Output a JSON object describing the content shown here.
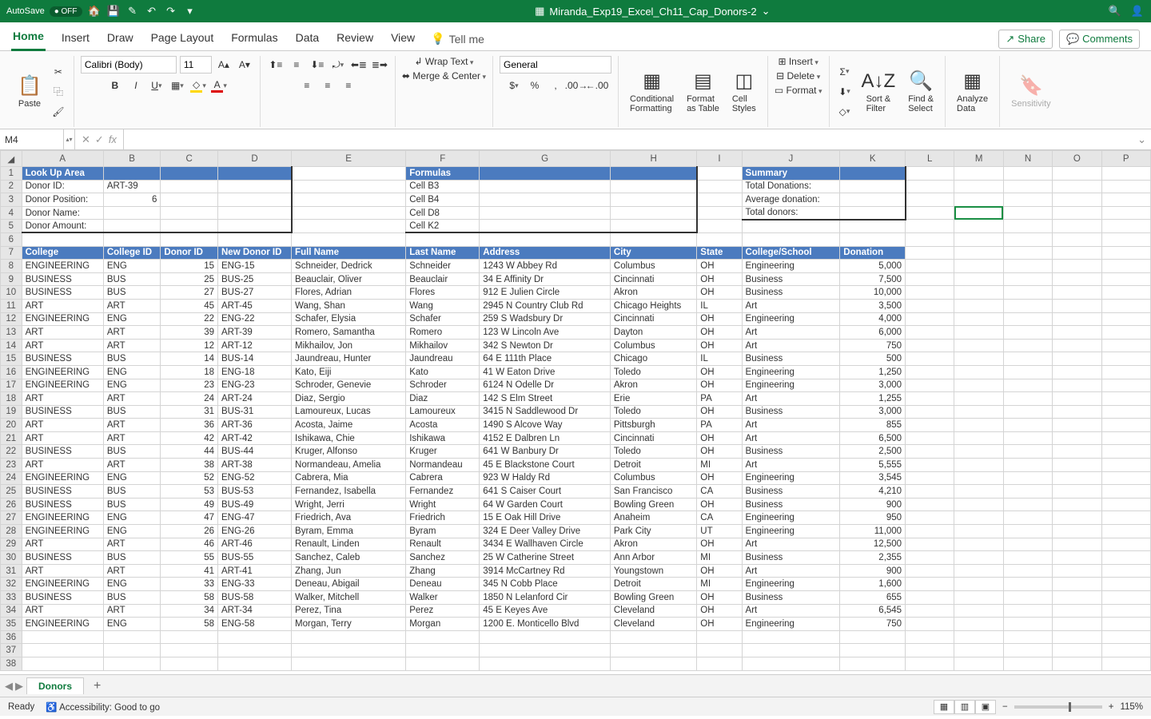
{
  "titlebar": {
    "autosave_label": "AutoSave",
    "autosave_state": "OFF",
    "filename": "Miranda_Exp19_Excel_Ch11_Cap_Donors-2",
    "icons": {
      "home": "🏠",
      "save": "💾",
      "share": "✎",
      "undo": "↶",
      "redo": "↷",
      "more": "⋯",
      "search": "🔍",
      "user": "👤"
    }
  },
  "ribbon_tabs": [
    "Home",
    "Insert",
    "Draw",
    "Page Layout",
    "Formulas",
    "Data",
    "Review",
    "View"
  ],
  "tellme_label": "Tell me",
  "share_label": "Share",
  "comments_label": "Comments",
  "ribbon": {
    "paste_label": "Paste",
    "font_name": "Calibri (Body)",
    "font_size": "11",
    "wrap_label": "Wrap Text",
    "merge_label": "Merge & Center",
    "number_format": "General",
    "cond_fmt_label": "Conditional\nFormatting",
    "fmt_table_label": "Format\nas Table",
    "cell_styles_label": "Cell\nStyles",
    "insert_label": "Insert",
    "delete_label": "Delete",
    "format_label": "Format",
    "sort_label": "Sort &\nFilter",
    "find_label": "Find &\nSelect",
    "analyze_label": "Analyze\nData",
    "sensitivity_label": "Sensitivity"
  },
  "namebox": "M4",
  "columns": [
    "A",
    "B",
    "C",
    "D",
    "E",
    "F",
    "G",
    "H",
    "I",
    "J",
    "K",
    "L",
    "M",
    "N",
    "O",
    "P"
  ],
  "active_col": "M",
  "sel_cell": "M4",
  "lookup_area_hdr": "Look Up Area",
  "formulas_hdr": "Formulas",
  "summary_hdr": "Summary",
  "lookup": {
    "donor_id_lbl": "Donor ID:",
    "donor_id_val": "ART-39",
    "donor_pos_lbl": "Donor Position:",
    "donor_pos_val": "6",
    "donor_name_lbl": "Donor Name:",
    "donor_amt_lbl": "Donor Amount:"
  },
  "formulas_cells": [
    "Cell B3",
    "Cell B4",
    "Cell D8",
    "Cell K2"
  ],
  "summary": {
    "total_don_lbl": "Total Donations:",
    "avg_don_lbl": "Average donation:",
    "total_donors_lbl": "Total donors:"
  },
  "headers": [
    "College",
    "College ID",
    "Donor ID",
    "New Donor ID",
    "Full Name",
    "Last Name",
    "Address",
    "City",
    "State",
    "College/School",
    "Donation"
  ],
  "rows": [
    [
      "ENGINEERING",
      "ENG",
      "15",
      "ENG-15",
      "Schneider, Dedrick",
      "Schneider",
      "1243 W Abbey Rd",
      "Columbus",
      "OH",
      "Engineering",
      "5,000"
    ],
    [
      "BUSINESS",
      "BUS",
      "25",
      "BUS-25",
      "Beauclair, Oliver",
      "Beauclair",
      "34 E Affinity Dr",
      "Cincinnati",
      "OH",
      "Business",
      "7,500"
    ],
    [
      "BUSINESS",
      "BUS",
      "27",
      "BUS-27",
      "Flores, Adrian",
      "Flores",
      "912 E Julien Circle",
      "Akron",
      "OH",
      "Business",
      "10,000"
    ],
    [
      "ART",
      "ART",
      "45",
      "ART-45",
      "Wang, Shan",
      "Wang",
      "2945 N Country Club Rd",
      "Chicago Heights",
      "IL",
      "Art",
      "3,500"
    ],
    [
      "ENGINEERING",
      "ENG",
      "22",
      "ENG-22",
      "Schafer, Elysia",
      "Schafer",
      "259 S Wadsbury Dr",
      "Cincinnati",
      "OH",
      "Engineering",
      "4,000"
    ],
    [
      "ART",
      "ART",
      "39",
      "ART-39",
      "Romero, Samantha",
      "Romero",
      "123 W Lincoln Ave",
      "Dayton",
      "OH",
      "Art",
      "6,000"
    ],
    [
      "ART",
      "ART",
      "12",
      "ART-12",
      "Mikhailov, Jon",
      "Mikhailov",
      "342 S Newton Dr",
      "Columbus",
      "OH",
      "Art",
      "750"
    ],
    [
      "BUSINESS",
      "BUS",
      "14",
      "BUS-14",
      "Jaundreau, Hunter",
      "Jaundreau",
      "64 E 111th Place",
      "Chicago",
      "IL",
      "Business",
      "500"
    ],
    [
      "ENGINEERING",
      "ENG",
      "18",
      "ENG-18",
      "Kato, Eiji",
      "Kato",
      "41 W Eaton Drive",
      "Toledo",
      "OH",
      "Engineering",
      "1,250"
    ],
    [
      "ENGINEERING",
      "ENG",
      "23",
      "ENG-23",
      "Schroder, Genevie",
      "Schroder",
      "6124 N Odelle Dr",
      "Akron",
      "OH",
      "Engineering",
      "3,000"
    ],
    [
      "ART",
      "ART",
      "24",
      "ART-24",
      "Diaz, Sergio",
      "Diaz",
      "142 S Elm Street",
      "Erie",
      "PA",
      "Art",
      "1,255"
    ],
    [
      "BUSINESS",
      "BUS",
      "31",
      "BUS-31",
      "Lamoureux, Lucas",
      "Lamoureux",
      "3415 N Saddlewood Dr",
      "Toledo",
      "OH",
      "Business",
      "3,000"
    ],
    [
      "ART",
      "ART",
      "36",
      "ART-36",
      "Acosta, Jaime",
      "Acosta",
      "1490 S Alcove Way",
      "Pittsburgh",
      "PA",
      "Art",
      "855"
    ],
    [
      "ART",
      "ART",
      "42",
      "ART-42",
      "Ishikawa, Chie",
      "Ishikawa",
      "4152 E Dalbren Ln",
      "Cincinnati",
      "OH",
      "Art",
      "6,500"
    ],
    [
      "BUSINESS",
      "BUS",
      "44",
      "BUS-44",
      "Kruger, Alfonso",
      "Kruger",
      "641 W Banbury Dr",
      "Toledo",
      "OH",
      "Business",
      "2,500"
    ],
    [
      "ART",
      "ART",
      "38",
      "ART-38",
      "Normandeau, Amelia",
      "Normandeau",
      "45 E Blackstone Court",
      "Detroit",
      "MI",
      "Art",
      "5,555"
    ],
    [
      "ENGINEERING",
      "ENG",
      "52",
      "ENG-52",
      "Cabrera, Mia",
      "Cabrera",
      "923 W Haldy Rd",
      "Columbus",
      "OH",
      "Engineering",
      "3,545"
    ],
    [
      "BUSINESS",
      "BUS",
      "53",
      "BUS-53",
      "Fernandez, Isabella",
      "Fernandez",
      "641 S Caiser Court",
      "San Francisco",
      "CA",
      "Business",
      "4,210"
    ],
    [
      "BUSINESS",
      "BUS",
      "49",
      "BUS-49",
      "Wright, Jerri",
      "Wright",
      "64 W Garden Court",
      "Bowling Green",
      "OH",
      "Business",
      "900"
    ],
    [
      "ENGINEERING",
      "ENG",
      "47",
      "ENG-47",
      "Friedrich, Ava",
      "Friedrich",
      "15 E Oak Hill Drive",
      "Anaheim",
      "CA",
      "Engineering",
      "950"
    ],
    [
      "ENGINEERING",
      "ENG",
      "26",
      "ENG-26",
      "Byram, Emma",
      "Byram",
      "324 E Deer Valley Drive",
      "Park City",
      "UT",
      "Engineering",
      "11,000"
    ],
    [
      "ART",
      "ART",
      "46",
      "ART-46",
      "Renault, Linden",
      "Renault",
      "3434 E Wallhaven Circle",
      "Akron",
      "OH",
      "Art",
      "12,500"
    ],
    [
      "BUSINESS",
      "BUS",
      "55",
      "BUS-55",
      "Sanchez, Caleb",
      "Sanchez",
      "25 W Catherine Street",
      "Ann Arbor",
      "MI",
      "Business",
      "2,355"
    ],
    [
      "ART",
      "ART",
      "41",
      "ART-41",
      "Zhang, Jun",
      "Zhang",
      "3914 McCartney Rd",
      "Youngstown",
      "OH",
      "Art",
      "900"
    ],
    [
      "ENGINEERING",
      "ENG",
      "33",
      "ENG-33",
      "Deneau, Abigail",
      "Deneau",
      "345 N Cobb Place",
      "Detroit",
      "MI",
      "Engineering",
      "1,600"
    ],
    [
      "BUSINESS",
      "BUS",
      "58",
      "BUS-58",
      "Walker, Mitchell",
      "Walker",
      "1850 N Lelanford Cir",
      "Bowling Green",
      "OH",
      "Business",
      "655"
    ],
    [
      "ART",
      "ART",
      "34",
      "ART-34",
      "Perez, Tina",
      "Perez",
      "45 E Keyes Ave",
      "Cleveland",
      "OH",
      "Art",
      "6,545"
    ],
    [
      "ENGINEERING",
      "ENG",
      "58",
      "ENG-58",
      "Morgan, Terry",
      "Morgan",
      "1200 E. Monticello Blvd",
      "Cleveland",
      "OH",
      "Engineering",
      "750"
    ]
  ],
  "sheet_tab": "Donors",
  "status": {
    "ready": "Ready",
    "accessibility": "Accessibility: Good to go",
    "zoom": "115%"
  }
}
